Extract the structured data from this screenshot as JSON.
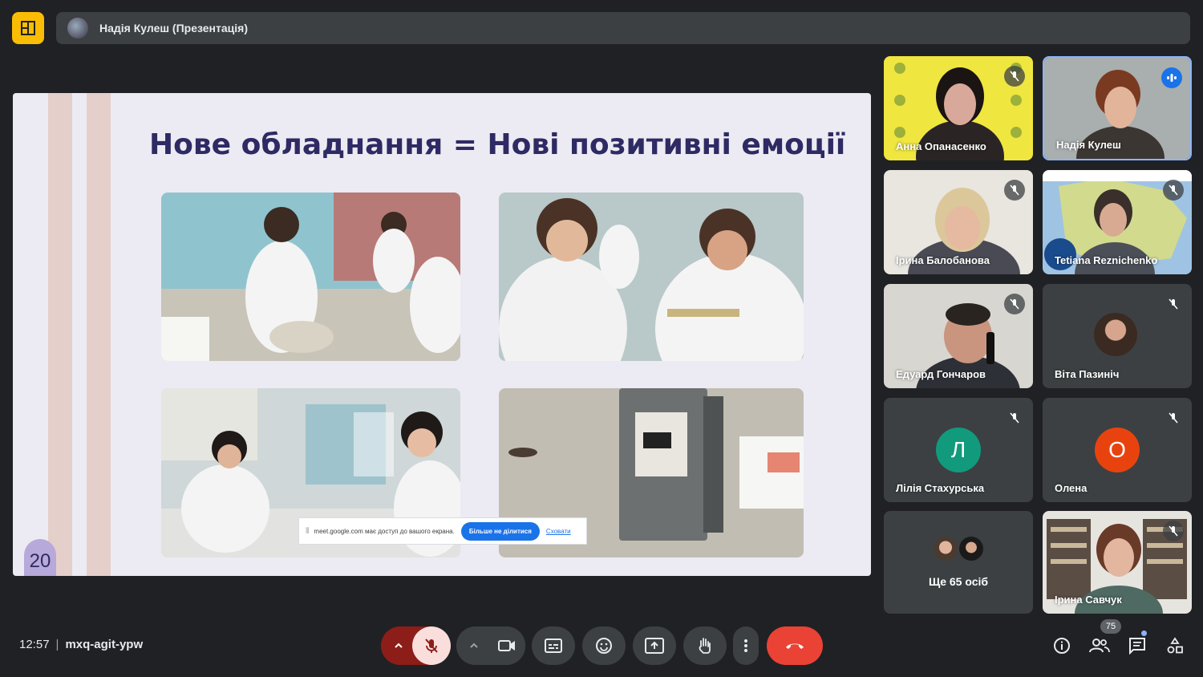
{
  "meeting": {
    "presenter_banner": "Надія Кулеш (Презентація)",
    "time": "12:57",
    "separator": "|",
    "code": "mxq-agit-ypw",
    "people_count": "75"
  },
  "slide": {
    "title": "Нове обладнання = Нові позитивні емоції",
    "page_number": "20"
  },
  "share_notice": {
    "grip": "⦀",
    "text": "meet.google.com має доступ до вашого екрана.",
    "stop_label": "Більше не ділитися",
    "hide_label": "Сховати"
  },
  "participants": [
    {
      "name": "Анна Опанасенко",
      "muted": true
    },
    {
      "name": "Надія Кулеш",
      "speaking": true
    },
    {
      "name": "Ірина Балобанова",
      "muted": true
    },
    {
      "name": "Tetiana Reznichenko",
      "muted": true
    },
    {
      "name": "Едуард Гончаров",
      "muted": true
    },
    {
      "name": "Віта Пазиніч",
      "muted": true
    },
    {
      "name": "Лілія Стахурська",
      "initial": "Л",
      "color": "#129a7c",
      "muted": true
    },
    {
      "name": "Олена",
      "initial": "О",
      "color": "#e8430e",
      "muted": true
    },
    {
      "name": "Ще 65 осіб"
    },
    {
      "name": "Ірина Савчук",
      "muted": true
    }
  ],
  "controls": [
    "chevron-up-icon",
    "mic-off-icon",
    "camera-icon",
    "captions-icon",
    "emoji-icon",
    "present-icon",
    "raise-hand-icon",
    "more-icon",
    "end-call-icon"
  ],
  "colors": {
    "background": "#202124",
    "tile": "#3c4043",
    "accent": "#8ab4f8",
    "end_call": "#ea4335",
    "mic_off_bg": "#f9dedc",
    "mic_off_expander": "#8c1d18"
  }
}
